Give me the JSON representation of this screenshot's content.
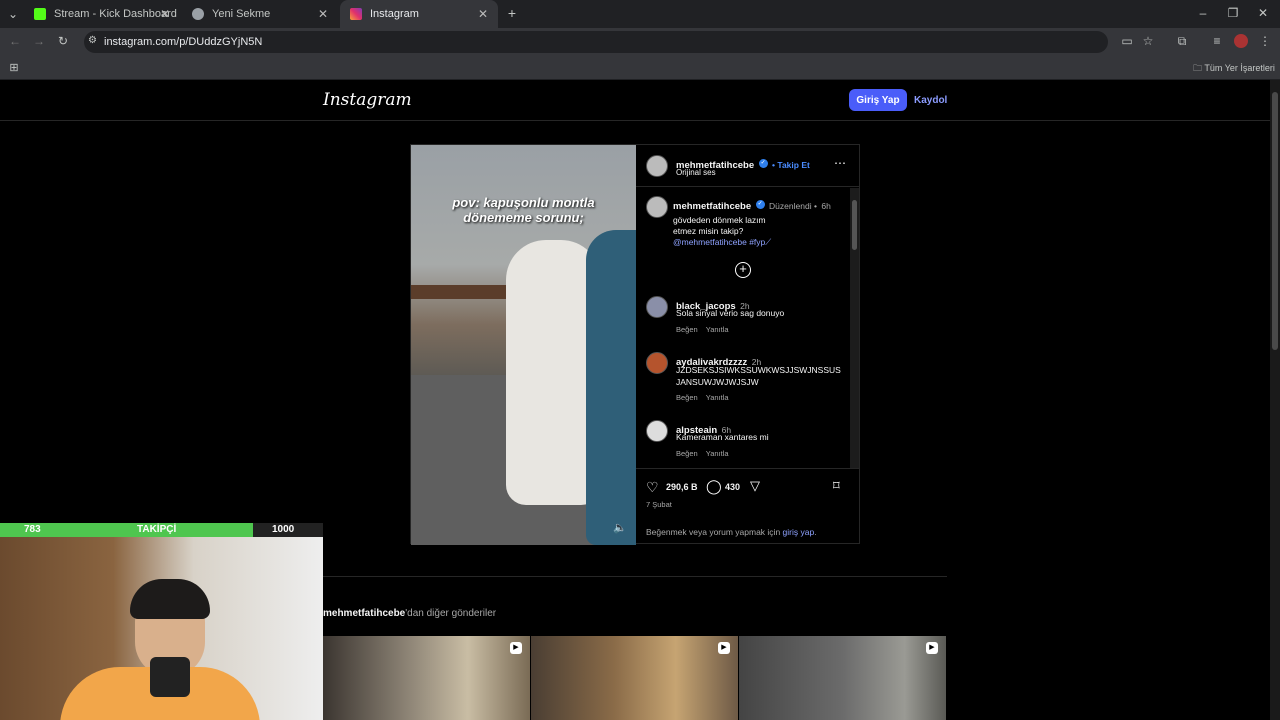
{
  "browser": {
    "tabs": [
      {
        "title": "Stream - Kick Dashboard",
        "favicon": "kick-icon",
        "color": "#53fc18"
      },
      {
        "title": "Yeni Sekme",
        "favicon": "chrome-icon",
        "color": "#9aa0a6"
      },
      {
        "title": "Instagram",
        "favicon": "instagram-icon",
        "color": "#e1306c"
      }
    ],
    "url": "instagram.com/p/DUddzGYjN5N",
    "bookmarks_label": "Tüm Yer İşaretleri"
  },
  "instagram": {
    "logo": "Instagram",
    "login_label": "Giriş Yap",
    "signup_label": "Kaydol",
    "accent": "#4a5df9",
    "post": {
      "video_overlay_text": "pov: kapuşonlu montla dönememe sorunu;",
      "author": "mehmetfatihcebe",
      "follow_label": "• Takip Et",
      "audio": "Orijinal ses",
      "caption": {
        "author": "mehmetfatihcebe",
        "edited": "Düzenlendi •",
        "time": "6h",
        "line1": "gövdeden dönmek lazım",
        "line2": "etmez misin takip?",
        "tags": "@mehmetfatihcebe #fyp⟋"
      },
      "comments": [
        {
          "user": "black_jacops",
          "time": "2h",
          "text": "Sola sinyal verio sag donuyo",
          "like": "Beğen",
          "reply": "Yanıtla"
        },
        {
          "user": "aydalivakrdzzzz",
          "time": "2h",
          "text": "JZDSEKSJSIWKSSUWKWSJJSWJNSSUSJANSUWJWJWJSJW",
          "like": "Beğen",
          "reply": "Yanıtla"
        },
        {
          "user": "alpsteain",
          "time": "6h",
          "text": "Kameraman xantares mi",
          "like": "Beğen",
          "reply": "Yanıtla"
        }
      ],
      "likes": "290,6 B",
      "comment_count": "430",
      "date": "7 Şubat",
      "login_prompt": "Beğenmek veya yorum yapmak için",
      "login_link": "giriş yap",
      "login_period": "."
    },
    "more_posts_user": "mehmetfatihcebe",
    "more_posts_suffix": "'dan diğer gönderiler"
  },
  "stream_overlay": {
    "current": "783",
    "label": "TAKİPÇİ",
    "goal": "1000",
    "progress": 0.783
  }
}
